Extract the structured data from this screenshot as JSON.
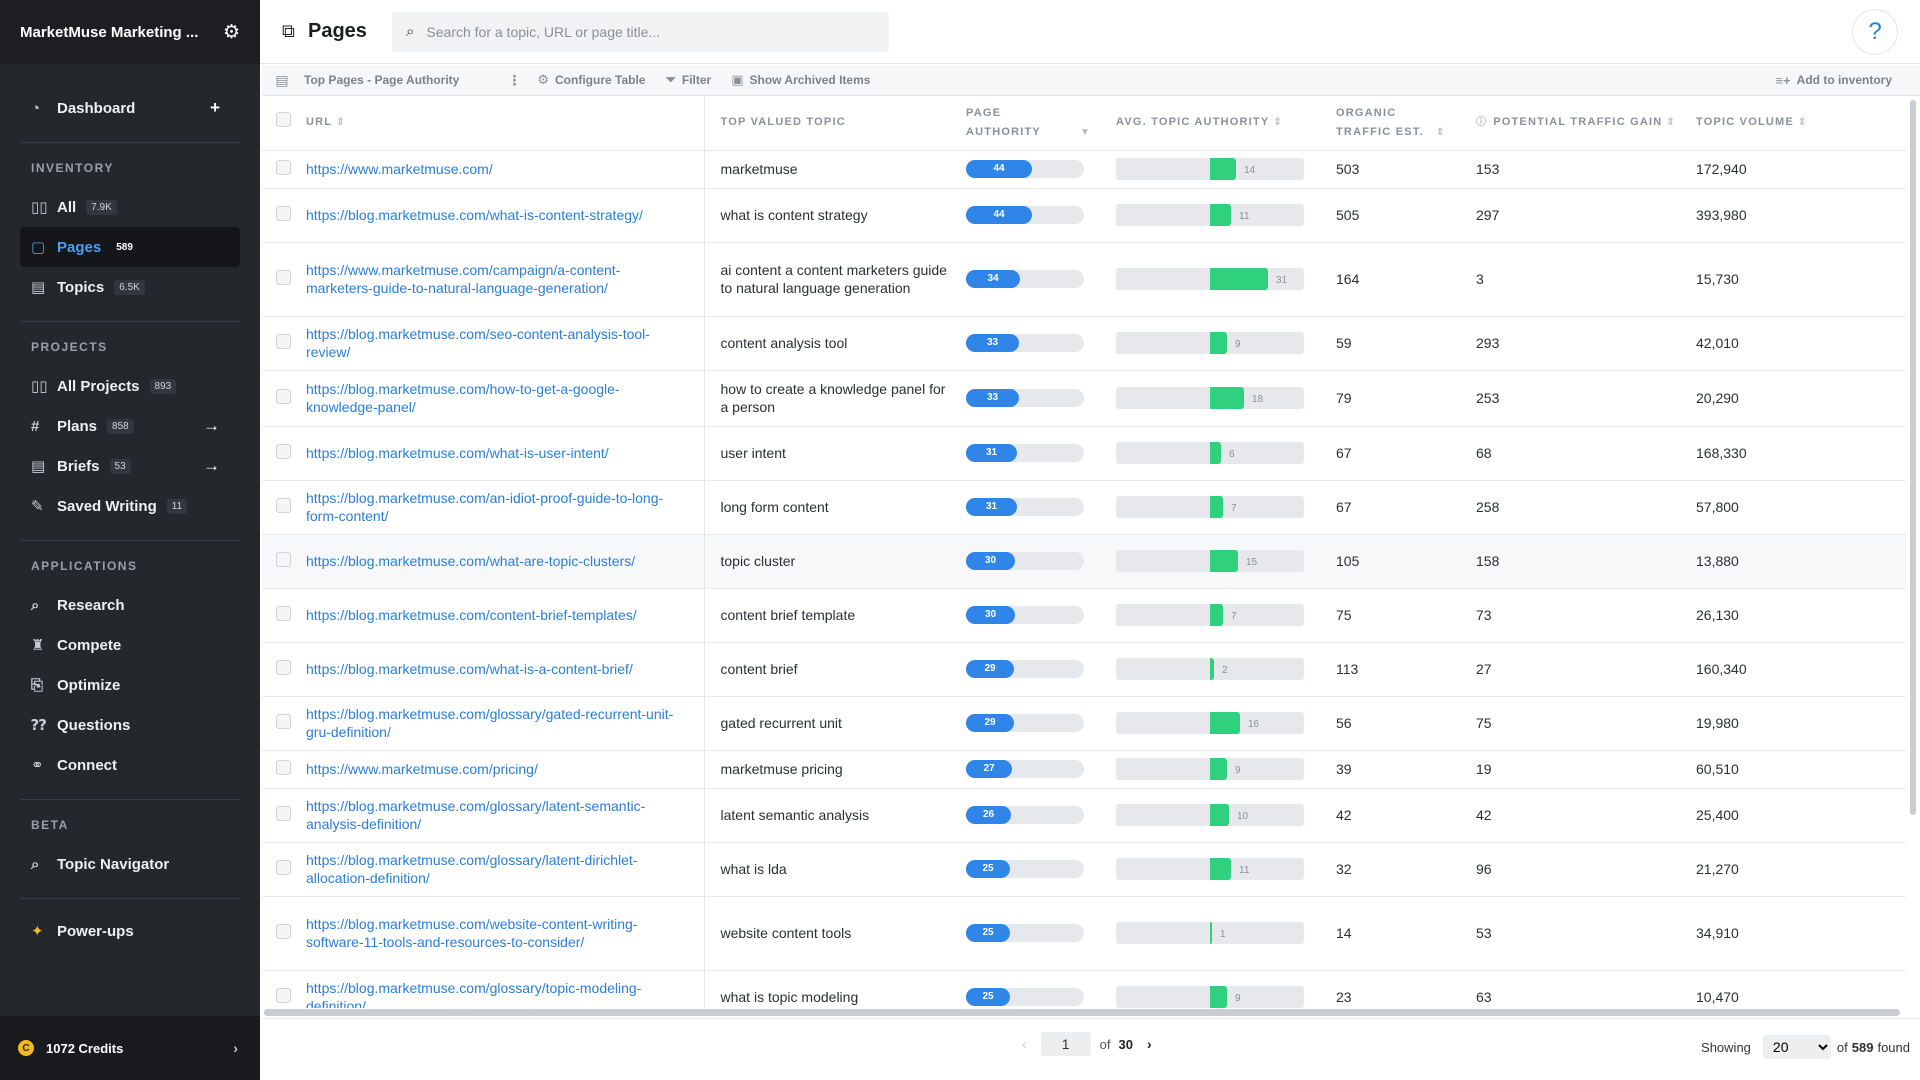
{
  "sidebar": {
    "org_name": "MarketMuse Marketing ...",
    "dashboard": {
      "label": "Dashboard",
      "plus": "+"
    },
    "inventory": {
      "heading": "INVENTORY",
      "items": [
        {
          "label": "All",
          "badge": "7.9K",
          "icon": "▯▯"
        },
        {
          "label": "Pages",
          "badge": "589",
          "icon": "▢"
        },
        {
          "label": "Topics",
          "badge": "6.5K",
          "icon": "▤"
        }
      ]
    },
    "projects": {
      "heading": "PROJECTS",
      "items": [
        {
          "label": "All Projects",
          "badge": "893",
          "icon": "▯▯"
        },
        {
          "label": "Plans",
          "badge": "858",
          "icon": "#",
          "arrow": "→"
        },
        {
          "label": "Briefs",
          "badge": "53",
          "icon": "▤",
          "arrow": "→"
        },
        {
          "label": "Saved Writing",
          "badge": "11",
          "icon": "✎"
        }
      ]
    },
    "applications": {
      "heading": "APPLICATIONS",
      "items": [
        {
          "label": "Research",
          "icon": "⌕"
        },
        {
          "label": "Compete",
          "icon": "♜"
        },
        {
          "label": "Optimize",
          "icon": "⎘"
        },
        {
          "label": "Questions",
          "icon": "⁇"
        },
        {
          "label": "Connect",
          "icon": "⚭"
        }
      ]
    },
    "beta": {
      "heading": "BETA",
      "items": [
        {
          "label": "Topic Navigator",
          "icon": "⌕"
        }
      ]
    },
    "powerups": {
      "label": "Power-ups",
      "icon": "✦"
    },
    "credits": {
      "label": "1072 Credits",
      "coin": "C",
      "chevron": "›"
    }
  },
  "header": {
    "title": "Pages",
    "search_placeholder": "Search for a topic, URL or page title...",
    "help": "?"
  },
  "toolbar": {
    "view_name": "Top Pages - Page Authority",
    "configure": "Configure Table",
    "filter": "Filter",
    "archived": "Show Archived Items",
    "add": "Add to inventory"
  },
  "columns": {
    "url": "URL",
    "topic": "TOP VALUED TOPIC",
    "pa": "PAGE AUTHORITY",
    "ta": "AVG. TOPIC AUTHORITY",
    "traffic": "ORGANIC TRAFFIC EST.",
    "gain": "POTENTIAL TRAFFIC GAIN",
    "volume": "TOPIC VOLUME"
  },
  "rows": [
    {
      "url": "https://www.marketmuse.com/",
      "topic": "marketmuse",
      "pa": 44,
      "ta": 14,
      "traffic": "503",
      "gain": "153",
      "volume": "172,940"
    },
    {
      "url": "https://blog.marketmuse.com/what-is-content-strategy/",
      "topic": "what is content strategy",
      "pa": 44,
      "ta": 11,
      "traffic": "505",
      "gain": "297",
      "volume": "393,980"
    },
    {
      "url": "https://www.marketmuse.com/campaign/a-content-marketers-guide-to-natural-language-generation/",
      "topic": "ai content a content marketers guide to natural language generation",
      "pa": 34,
      "ta": 31,
      "traffic": "164",
      "gain": "3",
      "volume": "15,730"
    },
    {
      "url": "https://blog.marketmuse.com/seo-content-analysis-tool-review/",
      "topic": "content analysis tool",
      "pa": 33,
      "ta": 9,
      "traffic": "59",
      "gain": "293",
      "volume": "42,010"
    },
    {
      "url": "https://blog.marketmuse.com/how-to-get-a-google-knowledge-panel/",
      "topic": "how to create a knowledge panel for a person",
      "pa": 33,
      "ta": 18,
      "traffic": "79",
      "gain": "253",
      "volume": "20,290"
    },
    {
      "url": "https://blog.marketmuse.com/what-is-user-intent/",
      "topic": "user intent",
      "pa": 31,
      "ta": 6,
      "traffic": "67",
      "gain": "68",
      "volume": "168,330"
    },
    {
      "url": "https://blog.marketmuse.com/an-idiot-proof-guide-to-long-form-content/",
      "topic": "long form content",
      "pa": 31,
      "ta": 7,
      "traffic": "67",
      "gain": "258",
      "volume": "57,800"
    },
    {
      "url": "https://blog.marketmuse.com/what-are-topic-clusters/",
      "topic": "topic cluster",
      "pa": 30,
      "ta": 15,
      "traffic": "105",
      "gain": "158",
      "volume": "13,880"
    },
    {
      "url": "https://blog.marketmuse.com/content-brief-templates/",
      "topic": "content brief template",
      "pa": 30,
      "ta": 7,
      "traffic": "75",
      "gain": "73",
      "volume": "26,130"
    },
    {
      "url": "https://blog.marketmuse.com/what-is-a-content-brief/",
      "topic": "content brief",
      "pa": 29,
      "ta": 2,
      "traffic": "113",
      "gain": "27",
      "volume": "160,340"
    },
    {
      "url": "https://blog.marketmuse.com/glossary/gated-recurrent-unit-gru-definition/",
      "topic": "gated recurrent unit",
      "pa": 29,
      "ta": 16,
      "traffic": "56",
      "gain": "75",
      "volume": "19,980"
    },
    {
      "url": "https://www.marketmuse.com/pricing/",
      "topic": "marketmuse pricing",
      "pa": 27,
      "ta": 9,
      "traffic": "39",
      "gain": "19",
      "volume": "60,510"
    },
    {
      "url": "https://blog.marketmuse.com/glossary/latent-semantic-analysis-definition/",
      "topic": "latent semantic analysis",
      "pa": 26,
      "ta": 10,
      "traffic": "42",
      "gain": "42",
      "volume": "25,400"
    },
    {
      "url": "https://blog.marketmuse.com/glossary/latent-dirichlet-allocation-definition/",
      "topic": "what is lda",
      "pa": 25,
      "ta": 11,
      "traffic": "32",
      "gain": "96",
      "volume": "21,270"
    },
    {
      "url": "https://blog.marketmuse.com/website-content-writing-software-11-tools-and-resources-to-consider/",
      "topic": "website content tools",
      "pa": 25,
      "ta": 1,
      "traffic": "14",
      "gain": "53",
      "volume": "34,910"
    },
    {
      "url": "https://blog.marketmuse.com/glossary/topic-modeling-definition/",
      "topic": "what is topic modeling",
      "pa": 25,
      "ta": 9,
      "traffic": "23",
      "gain": "63",
      "volume": "10,470"
    }
  ],
  "pagination": {
    "prev": "‹",
    "page": "1",
    "of": "of",
    "total_pages": "30",
    "next": "›",
    "showing": "Showing",
    "per_page": "20",
    "of_found": "of",
    "found_count": "589",
    "found": "found"
  },
  "colors": {
    "accent": "#2f86e8",
    "green": "#2fd07e",
    "sidebar": "#24272c"
  }
}
